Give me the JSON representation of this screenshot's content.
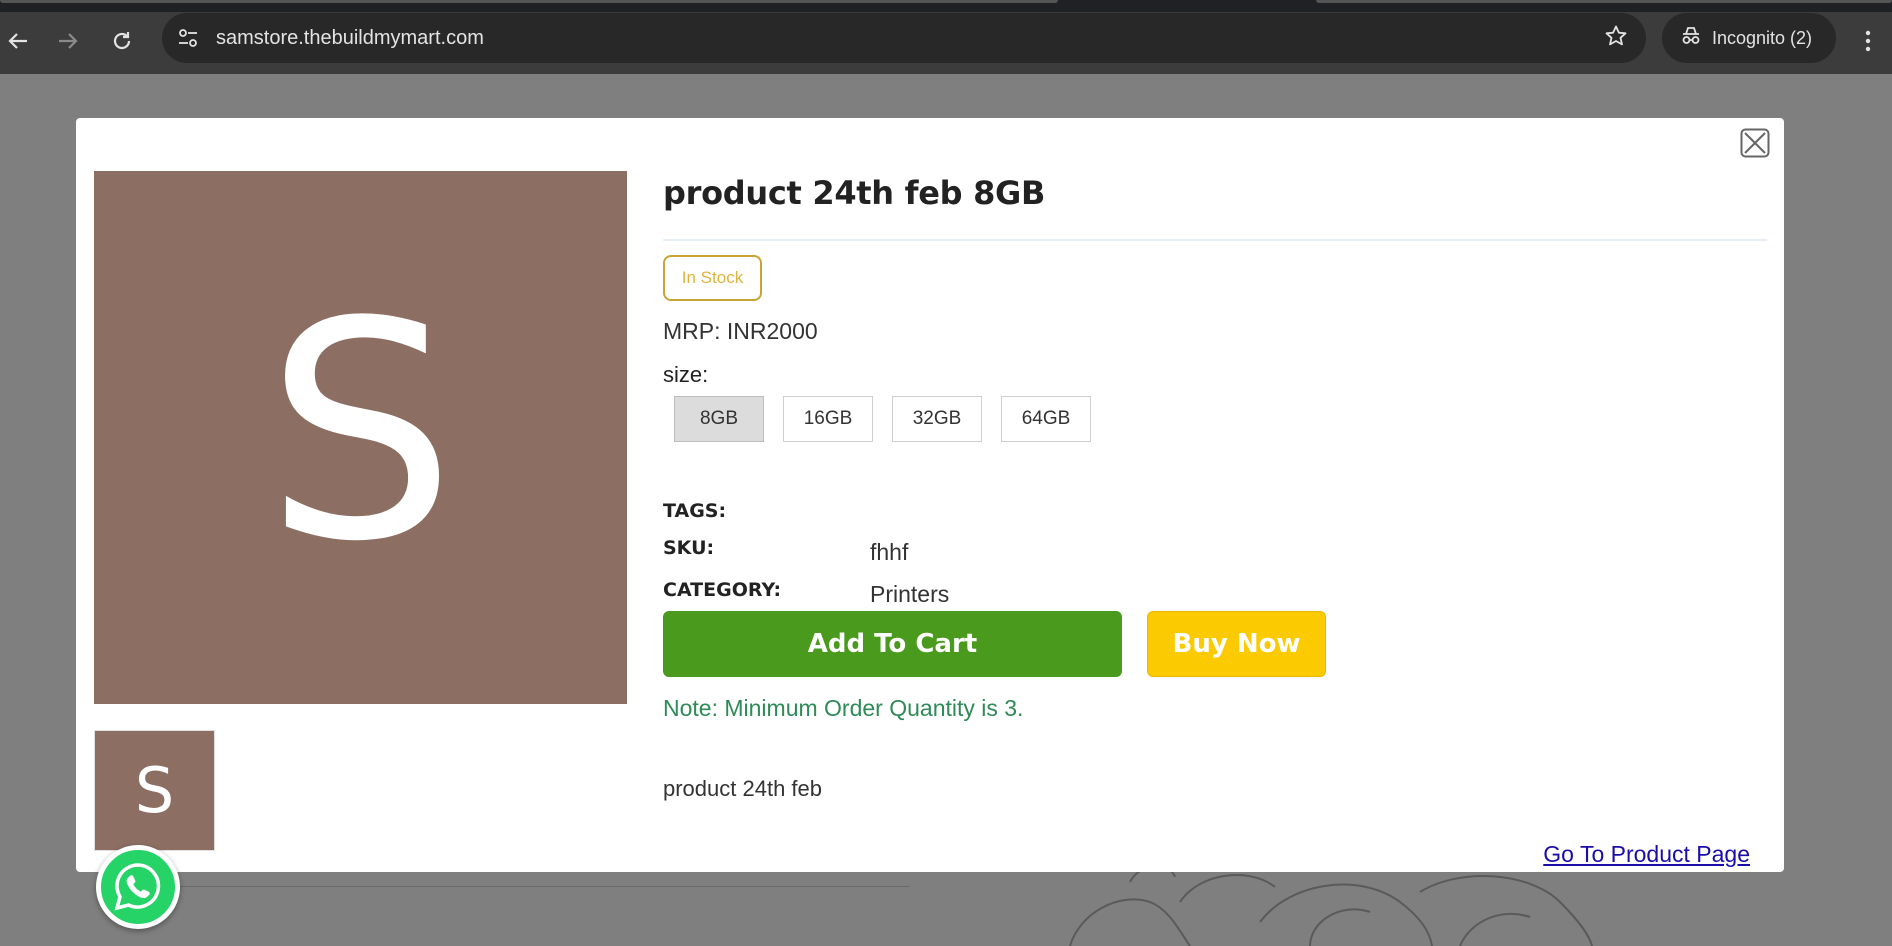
{
  "browser": {
    "url": "samstore.thebuildmymart.com",
    "incognito_label": "Incognito (2)",
    "icons": {
      "back": "back-arrow-icon",
      "forward": "forward-arrow-icon",
      "reload": "reload-icon",
      "site_info": "tune-icon",
      "bookmark": "star-icon",
      "incognito": "incognito-icon",
      "menu": "kebab-menu-icon"
    }
  },
  "modal": {
    "image_letter": "S",
    "thumbnail_letter": "S",
    "image_color": "#8d6e63",
    "title": "product 24th feb 8GB",
    "stock_badge": "In Stock",
    "mrp_label": "MRP:",
    "mrp_value": "INR2000",
    "size_label": "size:",
    "sizes": [
      "8GB",
      "16GB",
      "32GB",
      "64GB"
    ],
    "selected_size": "8GB",
    "tags_label": "TAGS:",
    "sku_label": "SKU:",
    "sku_value": "fhhf",
    "category_label": "CATEGORY:",
    "category_value": "Printers",
    "add_to_cart_label": "Add To Cart",
    "buy_now_label": "Buy Now",
    "note": "Note: Minimum Order Quantity is 3.",
    "description": "product 24th feb",
    "product_page_link": "Go To Product Page",
    "colors": {
      "add_to_cart": "#4a9a1d",
      "buy_now": "#fcca00",
      "note": "#2e8b57",
      "stock_badge": "#c9a335"
    }
  },
  "whatsapp": {
    "icon": "whatsapp-icon",
    "color": "#25d366"
  }
}
